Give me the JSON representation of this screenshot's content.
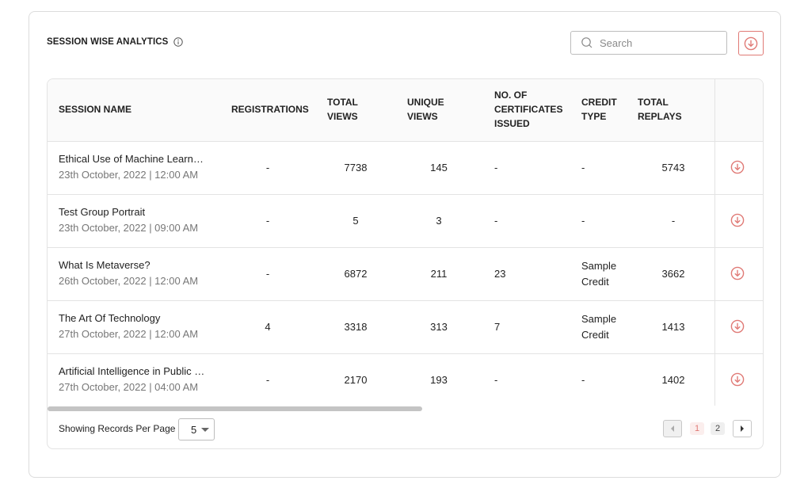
{
  "header": {
    "title": "SESSION WISE ANALYTICS",
    "search_placeholder": "Search"
  },
  "columns": {
    "session_name": "SESSION NAME",
    "registrations": "REGISTRATIONS",
    "total_views_1": "TOTAL",
    "total_views_2": "VIEWS",
    "unique_views_1": "UNIQUE",
    "unique_views_2": "VIEWS",
    "certificates_1": "NO. OF",
    "certificates_2": "CERTIFICATES",
    "certificates_3": "ISSUED",
    "credit_type_1": "CREDIT",
    "credit_type_2": "TYPE",
    "total_replays_1": "TOTAL",
    "total_replays_2": "REPLAYS"
  },
  "rows": [
    {
      "name": "Ethical Use of Machine Learning",
      "date": "23th October, 2022 | 12:00 AM",
      "registrations": "-",
      "total_views": "7738",
      "unique_views": "145",
      "certificates": "-",
      "credit_1": "-",
      "credit_2": "",
      "replays": "5743"
    },
    {
      "name": "Test Group Portrait",
      "date": "23th October, 2022 | 09:00 AM",
      "registrations": "-",
      "total_views": "5",
      "unique_views": "3",
      "certificates": "-",
      "credit_1": "-",
      "credit_2": "",
      "replays": "-"
    },
    {
      "name": "What Is Metaverse?",
      "date": "26th October, 2022 | 12:00 AM",
      "registrations": "-",
      "total_views": "6872",
      "unique_views": "211",
      "certificates": "23",
      "credit_1": "Sample",
      "credit_2": "Credit",
      "replays": "3662"
    },
    {
      "name": "The Art Of Technology",
      "date": "27th October, 2022 | 12:00 AM",
      "registrations": "4",
      "total_views": "3318",
      "unique_views": "313",
      "certificates": "7",
      "credit_1": "Sample",
      "credit_2": "Credit",
      "replays": "1413"
    },
    {
      "name": "Artificial Intelligence in Public Services",
      "date": "27th October, 2022 | 04:00 AM",
      "registrations": "-",
      "total_views": "2170",
      "unique_views": "193",
      "certificates": "-",
      "credit_1": "-",
      "credit_2": "",
      "replays": "1402"
    }
  ],
  "footer": {
    "per_page_label": "Showing Records Per Page",
    "per_page_value": "5",
    "pages": [
      "1",
      "2"
    ],
    "current_page": "1"
  },
  "colors": {
    "accent": "#e07a76",
    "border": "#e3e3e3"
  },
  "icons": {
    "info": "info-icon",
    "search": "search-icon",
    "download": "download-circle-icon",
    "prev": "chevron-left-icon",
    "next": "chevron-right-icon"
  }
}
